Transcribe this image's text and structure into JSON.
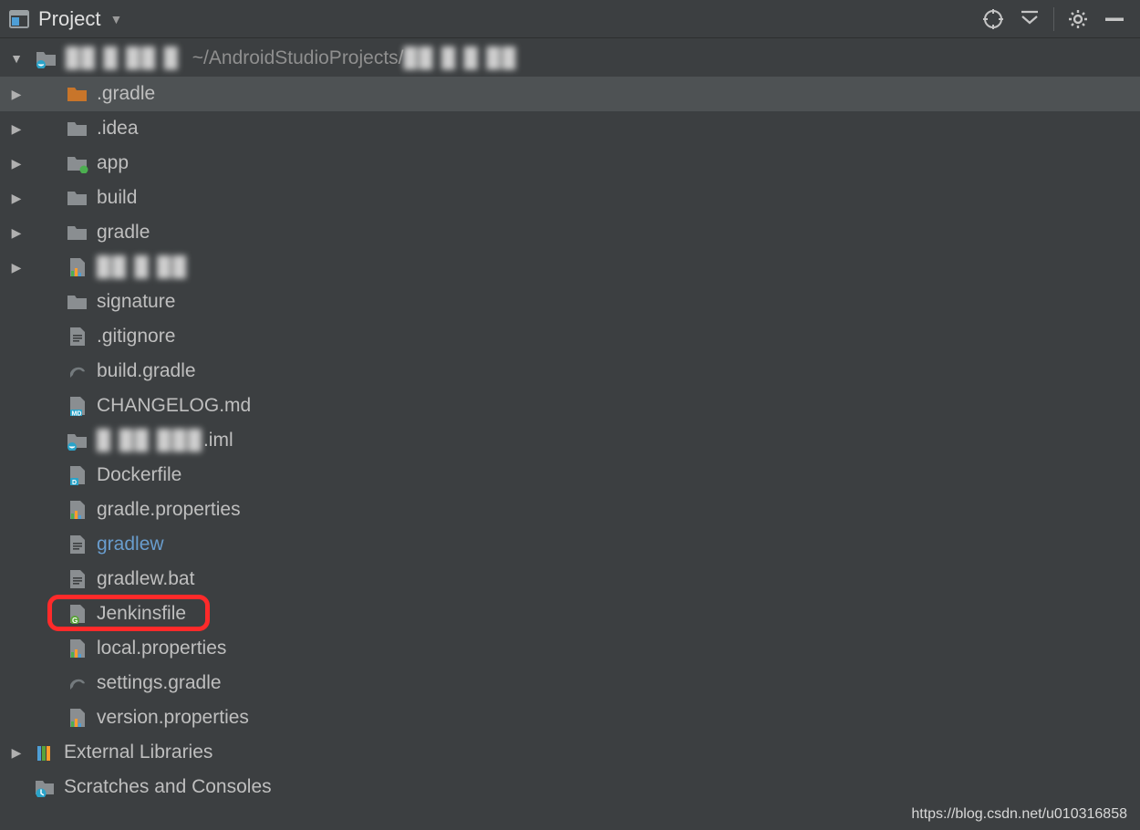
{
  "toolbar": {
    "title": "Project"
  },
  "tree": {
    "rootPath": "~/AndroidStudioProjects/",
    "items": [
      {
        "label": ".gradle",
        "icon": "folder-orange",
        "expandable": true,
        "depth": 1,
        "selected": true
      },
      {
        "label": ".idea",
        "icon": "folder-gray",
        "expandable": true,
        "depth": 1
      },
      {
        "label": "app",
        "icon": "folder-module",
        "expandable": true,
        "depth": 1
      },
      {
        "label": "build",
        "icon": "folder-gray",
        "expandable": true,
        "depth": 1
      },
      {
        "label": "gradle",
        "icon": "folder-gray",
        "expandable": true,
        "depth": 1
      },
      {
        "label": "",
        "icon": "chart",
        "expandable": true,
        "depth": 1,
        "redactedLabel": true
      },
      {
        "label": "signature",
        "icon": "folder-gray",
        "expandable": false,
        "depth": 1
      },
      {
        "label": ".gitignore",
        "icon": "text-file",
        "expandable": false,
        "depth": 1
      },
      {
        "label": "build.gradle",
        "icon": "gradle",
        "expandable": false,
        "depth": 1
      },
      {
        "label": "CHANGELOG.md",
        "icon": "md",
        "expandable": false,
        "depth": 1
      },
      {
        "label": ".iml",
        "icon": "module",
        "expandable": false,
        "depth": 1,
        "redactedPrefix": true
      },
      {
        "label": "Dockerfile",
        "icon": "docker",
        "expandable": false,
        "depth": 1
      },
      {
        "label": "gradle.properties",
        "icon": "chart",
        "expandable": false,
        "depth": 1
      },
      {
        "label": "gradlew",
        "icon": "text-file",
        "expandable": false,
        "depth": 1,
        "link": true
      },
      {
        "label": "gradlew.bat",
        "icon": "text-file",
        "expandable": false,
        "depth": 1
      },
      {
        "label": "Jenkinsfile",
        "icon": "groovy",
        "expandable": false,
        "depth": 1,
        "highlight": true
      },
      {
        "label": "local.properties",
        "icon": "chart",
        "expandable": false,
        "depth": 1
      },
      {
        "label": "settings.gradle",
        "icon": "gradle",
        "expandable": false,
        "depth": 1
      },
      {
        "label": "version.properties",
        "icon": "chart",
        "expandable": false,
        "depth": 1
      }
    ],
    "extLibs": "External Libraries",
    "scratches": "Scratches and Consoles"
  },
  "footer": "https://blog.csdn.net/u010316858"
}
